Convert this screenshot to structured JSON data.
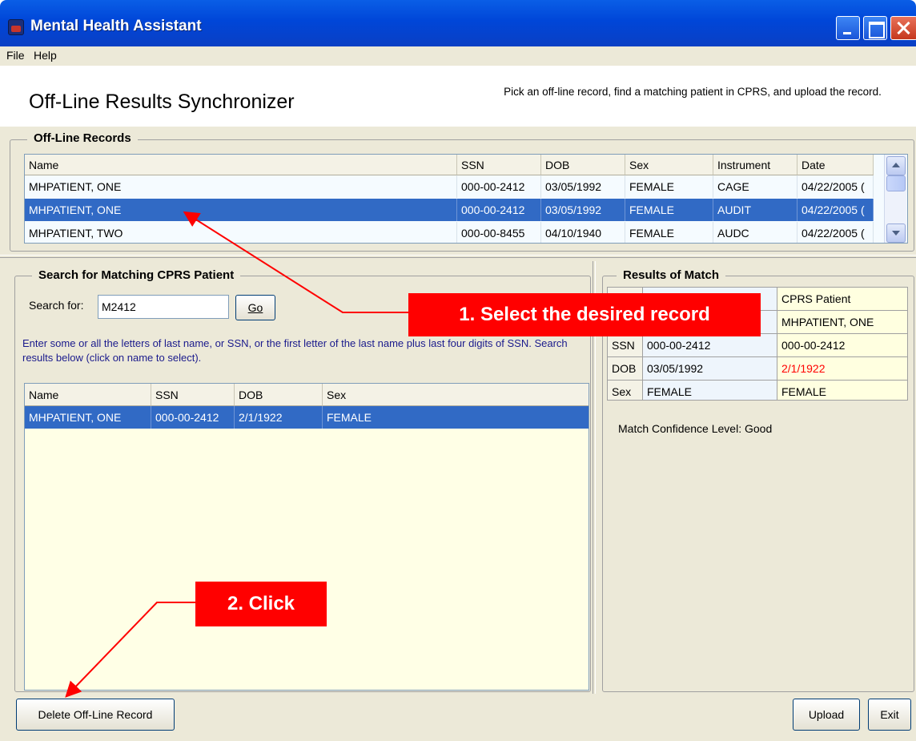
{
  "window": {
    "title": "Mental Health Assistant"
  },
  "menu": {
    "file": "File",
    "help": "Help"
  },
  "header": {
    "title": "Off-Line Results Synchronizer",
    "description": "Pick an off-line record, find a matching patient in CPRS, and upload the record."
  },
  "offline": {
    "legend": "Off-Line Records",
    "columns": [
      "Name",
      "SSN",
      "DOB",
      "Sex",
      "Instrument",
      "Date"
    ],
    "rows": [
      {
        "name": "MHPATIENT, ONE",
        "ssn": "000-00-2412",
        "dob": "03/05/1992",
        "sex": "FEMALE",
        "instrument": "CAGE",
        "date": "04/22/2005 (",
        "selected": false
      },
      {
        "name": "MHPATIENT, ONE",
        "ssn": "000-00-2412",
        "dob": "03/05/1992",
        "sex": "FEMALE",
        "instrument": "AUDIT",
        "date": "04/22/2005 (",
        "selected": true
      },
      {
        "name": "MHPATIENT, TWO",
        "ssn": "000-00-8455",
        "dob": "04/10/1940",
        "sex": "FEMALE",
        "instrument": "AUDC",
        "date": "04/22/2005 (",
        "selected": false
      }
    ]
  },
  "search": {
    "legend": "Search for Matching CPRS Patient",
    "label": "Search for:",
    "value": "M2412",
    "go_label": "Go",
    "help": "Enter some or all the letters of last name, or SSN, or the first letter of the last name plus last four digits of SSN. Search results below (click on name to select).",
    "columns": [
      "Name",
      "SSN",
      "DOB",
      "Sex"
    ],
    "rows": [
      {
        "name": "MHPATIENT, ONE",
        "ssn": "000-00-2412",
        "dob": "2/1/1922",
        "sex": "FEMALE",
        "selected": true
      }
    ]
  },
  "match": {
    "legend": "Results of Match",
    "header": [
      "",
      "",
      "CPRS Patient"
    ],
    "rows": [
      {
        "key": "",
        "offline": "",
        "cprs": "MHPATIENT, ONE",
        "mismatch": false
      },
      {
        "key": "SSN",
        "offline": "000-00-2412",
        "cprs": "000-00-2412",
        "mismatch": false
      },
      {
        "key": "DOB",
        "offline": "03/05/1992",
        "cprs": "2/1/1922",
        "mismatch": true
      },
      {
        "key": "Sex",
        "offline": "FEMALE",
        "cprs": "FEMALE",
        "mismatch": false
      }
    ],
    "confidence": "Match Confidence Level: Good",
    "mismatch_color": "#ff0000"
  },
  "buttons": {
    "delete": "Delete Off-Line Record",
    "upload": "Upload",
    "exit": "Exit"
  },
  "callouts": {
    "one": "1. Select the desired record",
    "two": "2. Click",
    "color": "#ff0000"
  }
}
